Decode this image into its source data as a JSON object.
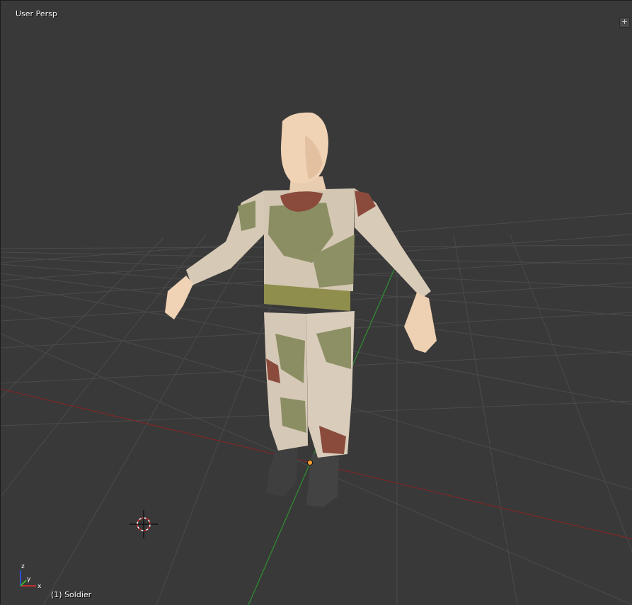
{
  "viewport": {
    "view_label": "User Persp",
    "object_label": "(1) Soldier",
    "corner_widget_icon": "plus-icon"
  },
  "axes_gizmo": {
    "z_label": "z",
    "y_label": "y",
    "x_label": "x"
  },
  "colors": {
    "background": "#393939",
    "grid": "#4d4d4d",
    "x_axis": "#8a2a2a",
    "y_axis": "#2f8a2f",
    "skin": "#f0d2b4",
    "camo_base": "#d9ccbb",
    "camo_green": "#8a8e62",
    "camo_brown": "#8a4a3c",
    "belt": "#8f8e4d",
    "boots": "#3e3e3e"
  },
  "model": {
    "name_icon": "soldier-mesh"
  }
}
